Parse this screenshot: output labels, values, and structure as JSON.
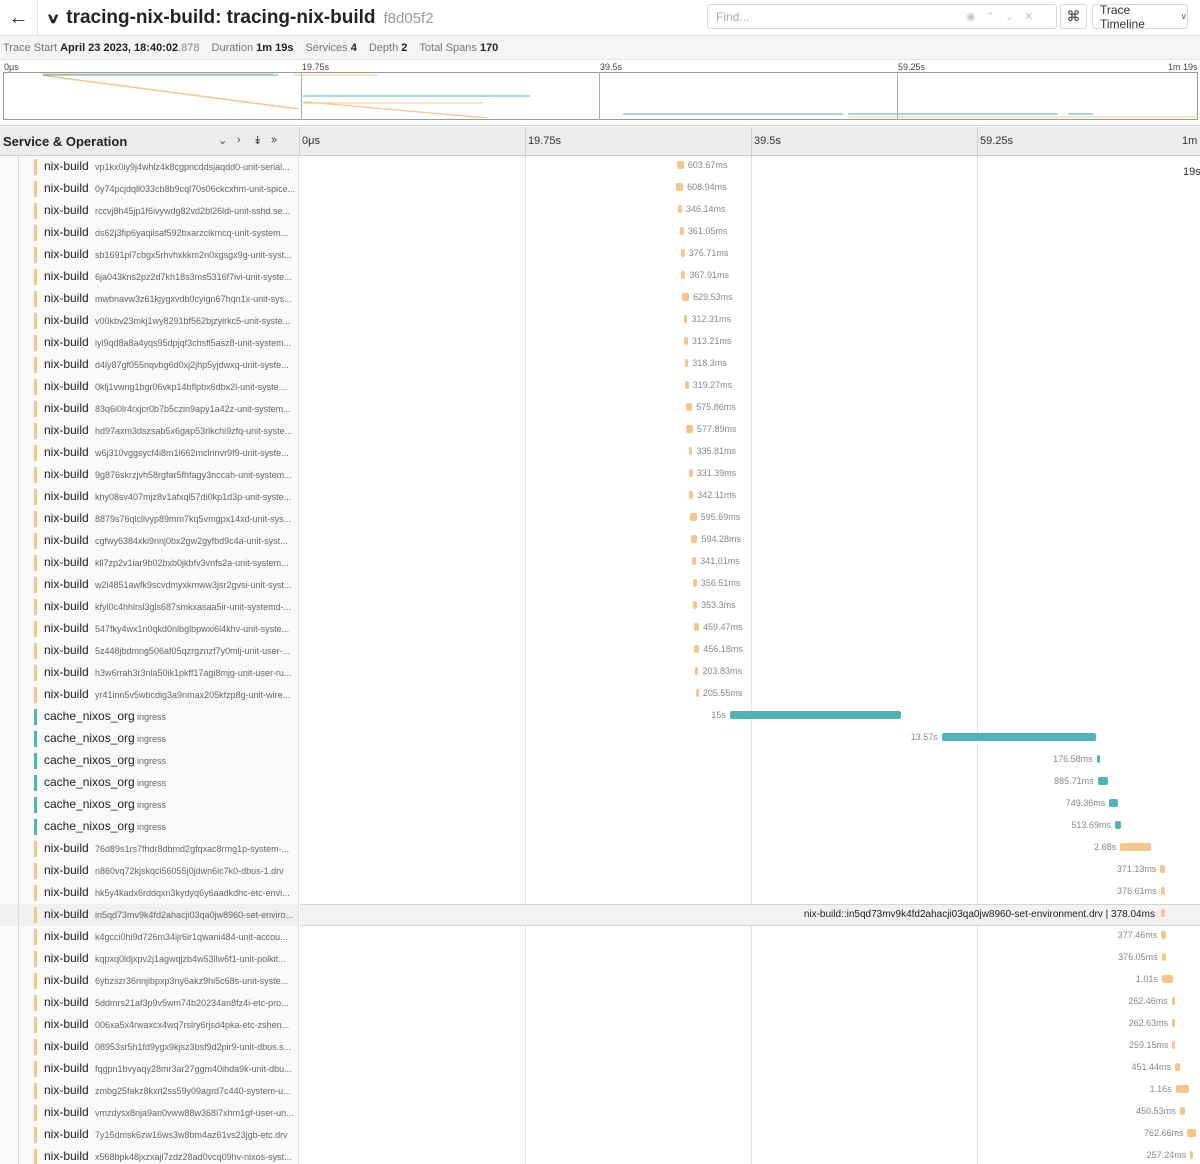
{
  "header": {
    "title": "tracing-nix-build: tracing-nix-build",
    "trace_id": "f8d05f2",
    "find_placeholder": "Find...",
    "view_label": "Trace Timeline"
  },
  "summary": {
    "trace_start_label": "Trace Start",
    "trace_start_value": "April 23 2023, 18:40:02",
    "trace_start_ms": ".878",
    "duration_label": "Duration",
    "duration_value": "1m 19s",
    "services_label": "Services",
    "services_value": "4",
    "depth_label": "Depth",
    "depth_value": "2",
    "total_spans_label": "Total Spans",
    "total_spans_value": "170"
  },
  "minimap": {
    "ticks": [
      "0μs",
      "19.75s",
      "39.5s",
      "59.25s",
      "1m 19s"
    ]
  },
  "columns": {
    "service_operation": "Service & Operation",
    "ticks": [
      "0μs",
      "19.75s",
      "39.5s",
      "59.25s",
      "1m"
    ],
    "tick_tail": "19s"
  },
  "colors": {
    "nix_build": "#f5c58a",
    "cache_nixos_org": "#4fb3b8"
  },
  "rows": [
    {
      "service": "nix-build",
      "op": "vp1kx0iy9j4whlz4k8cgpncddsjaqdd0-unit-serial...",
      "start": 0.4188,
      "dur": "603.67ms",
      "durs": 0.6037
    },
    {
      "service": "nix-build",
      "op": "0y74pcjdqll033cb8b9cql70s06ckcxhm-unit-spice...",
      "start": 0.418,
      "dur": "608.94ms",
      "durs": 0.6089
    },
    {
      "service": "nix-build",
      "op": "rccvj8h45jp1f6ivywdg82vd2bl26ldi-unit-sshd.se...",
      "start": 0.42,
      "dur": "346.14ms",
      "durs": 0.3461
    },
    {
      "service": "nix-build",
      "op": "ds62j3fip6yaqiisaf592bxarzcikmcq-unit-system...",
      "start": 0.422,
      "dur": "361.05ms",
      "durs": 0.3611
    },
    {
      "service": "nix-build",
      "op": "sb1691pl7cbgx5rhvhxkkm2n0xgsgx9g-unit-syst...",
      "start": 0.4228,
      "dur": "376.71ms",
      "durs": 0.3767
    },
    {
      "service": "nix-build",
      "op": "6ja043kns2pz2d7kh18s3ms5316f7ivi-unit-syste...",
      "start": 0.4236,
      "dur": "367.91ms",
      "durs": 0.3679
    },
    {
      "service": "nix-build",
      "op": "mwbnavw3z61kjygxvdb0cyign67hqn1x-unit-sys...",
      "start": 0.4244,
      "dur": "629.53ms",
      "durs": 0.6295
    },
    {
      "service": "nix-build",
      "op": "v00kbv23mkj1wy8291bf562bjzyirkc5-unit-syste...",
      "start": 0.4266,
      "dur": "312.31ms",
      "durs": 0.3123
    },
    {
      "service": "nix-build",
      "op": "iyl9qd8a8a4yqs95dpjqf3chsfl5asz8-unit-system...",
      "start": 0.427,
      "dur": "313.21ms",
      "durs": 0.3132
    },
    {
      "service": "nix-build",
      "op": "d4ly87gf055nqvbg6d0xj2jhp5yjdwxq-unit-syste...",
      "start": 0.4274,
      "dur": "318.3ms",
      "durs": 0.3183
    },
    {
      "service": "nix-build",
      "op": "0klj1vwng1bgr06vkp14bflpbx6dbx2l-unit-syste...",
      "start": 0.4277,
      "dur": "319.27ms",
      "durs": 0.3193
    },
    {
      "service": "nix-build",
      "op": "83q6i0lr4rxjcr0b7b5czin9apy1a42z-unit-system...",
      "start": 0.4285,
      "dur": "575.86ms",
      "durs": 0.5759
    },
    {
      "service": "nix-build",
      "op": "hd97axm3dszsab5x6gap53rlkchi9zfq-unit-syste...",
      "start": 0.4293,
      "dur": "577.89ms",
      "durs": 0.5779
    },
    {
      "service": "nix-build",
      "op": "w6j310vggsycf4i8m1l662mclnnvr9f9-unit-syste...",
      "start": 0.4318,
      "dur": "335.81ms",
      "durs": 0.3358
    },
    {
      "service": "nix-build",
      "op": "9g876skrzjvh58rgfar5fhfagy3nccah-unit-system...",
      "start": 0.4322,
      "dur": "331.39ms",
      "durs": 0.3314
    },
    {
      "service": "nix-build",
      "op": "khy08sv407mjz8v1afxql57di0kp1d3p-unit-syste...",
      "start": 0.4326,
      "dur": "342.11ms",
      "durs": 0.3421
    },
    {
      "service": "nix-build",
      "op": "8879s76qlcllvyp89mm7kq5vmgpx14xd-unit-sys...",
      "start": 0.4333,
      "dur": "595.69ms",
      "durs": 0.5957
    },
    {
      "service": "nix-build",
      "op": "cgfwy6384xki9nnj0bx2gw2gyfbd9c4a-unit-syst...",
      "start": 0.4341,
      "dur": "594.28ms",
      "durs": 0.5943
    },
    {
      "service": "nix-build",
      "op": "kll7zp2v1iar9b02bxb0jkbfv3vnfs2a-unit-system...",
      "start": 0.436,
      "dur": "341.01ms",
      "durs": 0.341
    },
    {
      "service": "nix-build",
      "op": "w2i4851awfk9scvdmyxkmww3jsr2gvsi-unit-syst...",
      "start": 0.4364,
      "dur": "356.51ms",
      "durs": 0.3565
    },
    {
      "service": "nix-build",
      "op": "kfyl0c4hhlrsl3gls687smkxasaa5ir-unit-systemd-...",
      "start": 0.4368,
      "dur": "353.3ms",
      "durs": 0.3533
    },
    {
      "service": "nix-build",
      "op": "547fky4wx1n0qkd0nlbglbpwxi6l4khv-unit-syste...",
      "start": 0.4375,
      "dur": "459.47ms",
      "durs": 0.4595
    },
    {
      "service": "nix-build",
      "op": "5z448jbdmng506af05qzrgznzf7y0mlj-unit-user-...",
      "start": 0.4379,
      "dur": "456.18ms",
      "durs": 0.4562
    },
    {
      "service": "nix-build",
      "op": "h3w6rrah3r3nla50ik1pkff17agi8mjg-unit-user-ru...",
      "start": 0.4394,
      "dur": "203.83ms",
      "durs": 0.2038
    },
    {
      "service": "nix-build",
      "op": "yr41inn5v5wbcdig3a9nmax205kfzp8g-unit-wire...",
      "start": 0.4398,
      "dur": "205.55ms",
      "durs": 0.2056
    },
    {
      "service": "cache_nixos_org",
      "op": "ingress",
      "start": 0.4776,
      "dur": "15s",
      "durs": 15.0
    },
    {
      "service": "cache_nixos_org",
      "op": "ingress",
      "start": 0.7131,
      "dur": "13.57s",
      "durs": 13.57
    },
    {
      "service": "cache_nixos_org",
      "op": "ingress",
      "start": 0.8851,
      "dur": "176.58ms",
      "durs": 0.1766
    },
    {
      "service": "cache_nixos_org",
      "op": "ingress",
      "start": 0.8862,
      "dur": "885.71ms",
      "durs": 0.8857
    },
    {
      "service": "cache_nixos_org",
      "op": "ingress",
      "start": 0.8992,
      "dur": "749.36ms",
      "durs": 0.7494
    },
    {
      "service": "cache_nixos_org",
      "op": "ingress",
      "start": 0.9055,
      "dur": "513.69ms",
      "durs": 0.5137
    },
    {
      "service": "nix-build",
      "op": "76d89s1rs7fhdr8dbmd2gfqxac8rmg1p-system-...",
      "start": 0.9113,
      "dur": "2.68s",
      "durs": 2.68
    },
    {
      "service": "nix-build",
      "op": "n860vq72kjskqci56055j0jdwn6ic7k0-dbus-1.drv",
      "start": 0.956,
      "dur": "371.13ms",
      "durs": 0.3711
    },
    {
      "service": "nix-build",
      "op": "hk5y4kadx6rddqxn3kydyq6y6aadkdhc-etc-envi...",
      "start": 0.9563,
      "dur": "376.61ms",
      "durs": 0.3766
    },
    {
      "service": "nix-build",
      "op": "in5qd73mv9k4fd2ahacji03qa0jw8960-set-enviro...",
      "start": 0.9566,
      "dur": "378.04ms",
      "durs": 0.378,
      "highlight": true,
      "hl_label": "nix-build::in5qd73mv9k4fd2ahacji03qa0jw8960-set-environment.drv | 378.04ms"
    },
    {
      "service": "nix-build",
      "op": "k4gcci0hi9d726m34ijr6ir1qwani484-unit-accou...",
      "start": 0.957,
      "dur": "377.46ms",
      "durs": 0.3775
    },
    {
      "service": "nix-build",
      "op": "kqpxq0ldjxpv2j1agwqjzb4w53llw6f1-unit-polkit...",
      "start": 0.9574,
      "dur": "376.05ms",
      "durs": 0.3761
    },
    {
      "service": "nix-build",
      "op": "6ybzszr36nnjibpxp3ny6akz9hi5c68s-unit-syste...",
      "start": 0.9576,
      "dur": "1.01s",
      "durs": 1.01
    },
    {
      "service": "nix-build",
      "op": "5ddmrs21af3p9v5wm74b20234an8fz4i-etc-pro...",
      "start": 0.9686,
      "dur": "262.46ms",
      "durs": 0.2625
    },
    {
      "service": "nix-build",
      "op": "006xa5x4rwaxcx4wq7rslry6rjsd4pka-etc-zshen...",
      "start": 0.969,
      "dur": "262.63ms",
      "durs": 0.2626
    },
    {
      "service": "nix-build",
      "op": "08953sr5h1fd9ygx9kjsz3bsf9d2pir9-unit-dbus.s...",
      "start": 0.9694,
      "dur": "259.15ms",
      "durs": 0.2592
    },
    {
      "service": "nix-build",
      "op": "fqgpn1bvyaqy28mr3ar27ggm40ihda9k-unit-dbu...",
      "start": 0.9722,
      "dur": "451.44ms",
      "durs": 0.4514
    },
    {
      "service": "nix-build",
      "op": "zmbg25fakz8kxri2ss59y09agrd7c440-system-u...",
      "start": 0.973,
      "dur": "1.16s",
      "durs": 1.16
    },
    {
      "service": "nix-build",
      "op": "vmzdysx8nja9an0vww88w368l7xhm1gf-user-un...",
      "start": 0.9774,
      "dur": "450.53ms",
      "durs": 0.4505
    },
    {
      "service": "nix-build",
      "op": "7y15dmsk6zw16ws3w8bm4az61vs23jgb-etc.drv",
      "start": 0.9861,
      "dur": "762.66ms",
      "durs": 0.7627
    },
    {
      "service": "nix-build",
      "op": "x568bpk48jxzxajl7zdz28ad0vcq09hv-nixos-syst...",
      "start": 0.9891,
      "dur": "257.24ms",
      "durs": 0.2572
    }
  ]
}
